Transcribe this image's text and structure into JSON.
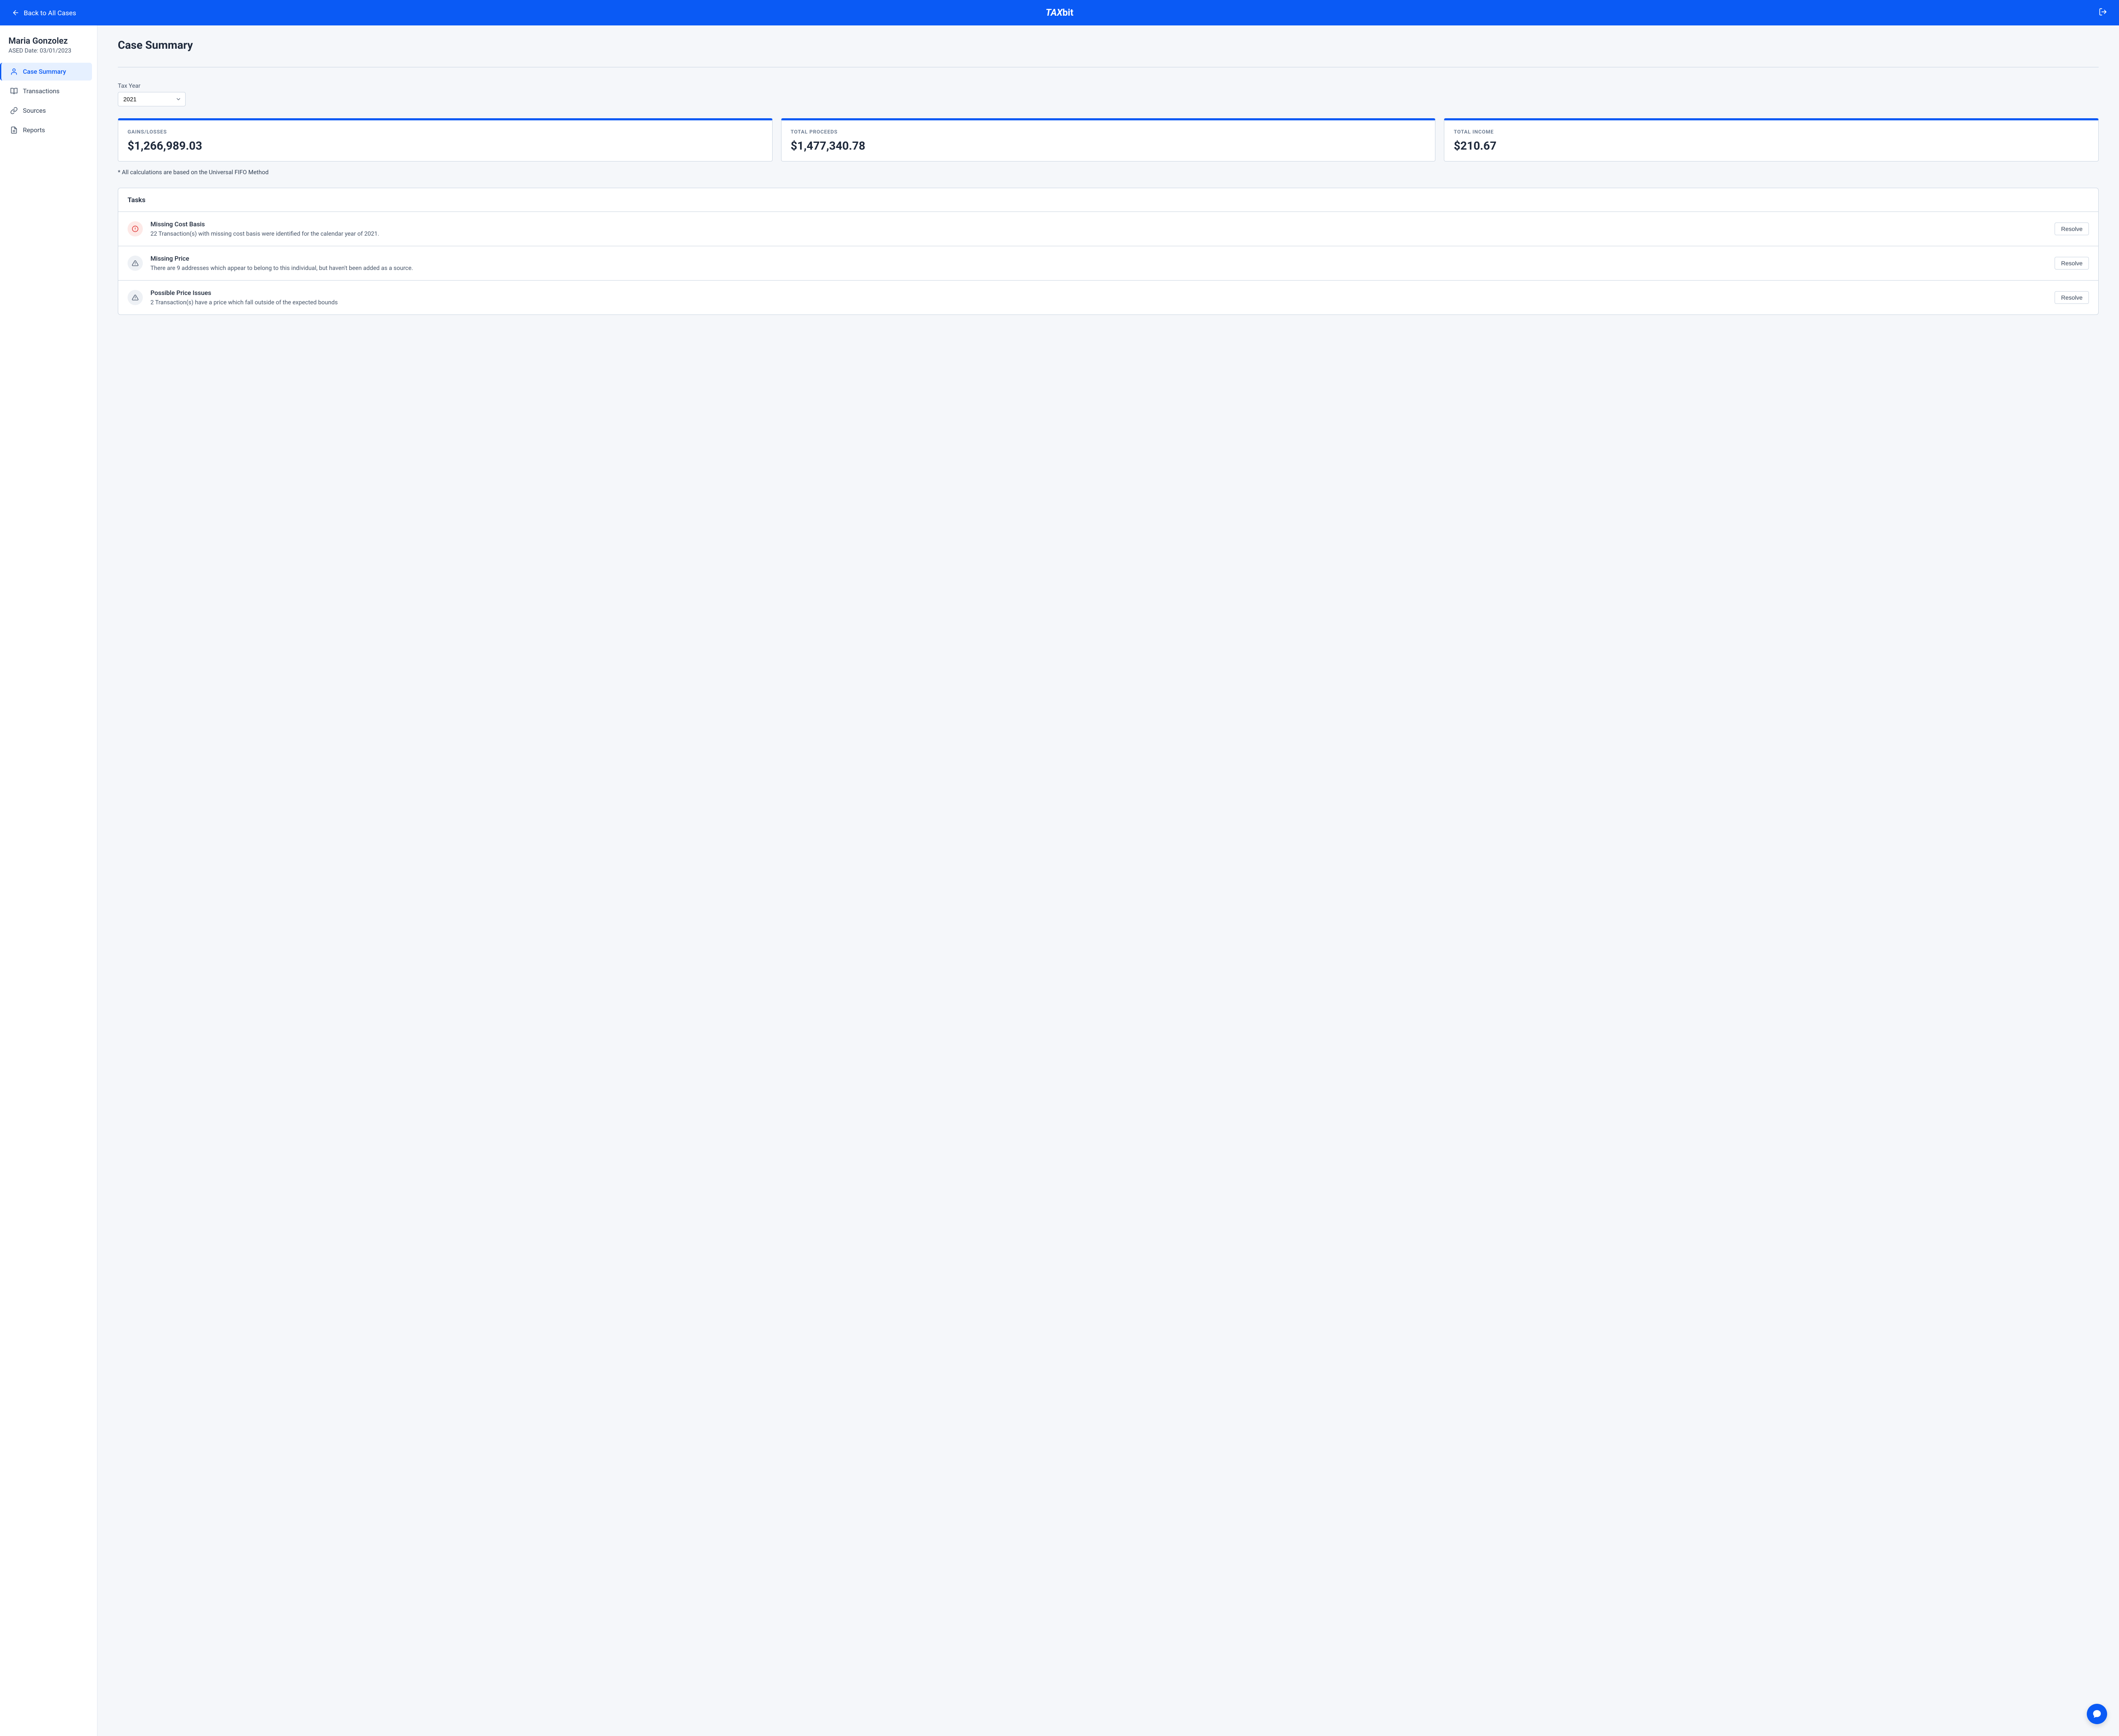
{
  "header": {
    "back_label": "Back to All Cases",
    "logo_prefix": "TAX",
    "logo_suffix": "bit"
  },
  "sidebar": {
    "person_name": "Maria Gonzolez",
    "ased_line": "ASED Date: 03/01/2023",
    "items": [
      {
        "label": "Case Summary",
        "icon": "person-icon",
        "active": true
      },
      {
        "label": "Transactions",
        "icon": "book-icon",
        "active": false
      },
      {
        "label": "Sources",
        "icon": "link-icon",
        "active": false
      },
      {
        "label": "Reports",
        "icon": "file-icon",
        "active": false
      }
    ]
  },
  "main": {
    "page_title": "Case Summary",
    "tax_year_label": "Tax Year",
    "tax_year_value": "2021",
    "cards": [
      {
        "label": "GAINS/LOSSES",
        "value": "$1,266,989.03"
      },
      {
        "label": "TOTAL PROCEEDS",
        "value": "$1,477,340.78"
      },
      {
        "label": "TOTAL INCOME",
        "value": "$210.67"
      }
    ],
    "footnote": "* All calculations are based on the Universal FIFO Method",
    "tasks_header": "Tasks",
    "resolve_label": "Resolve",
    "tasks": [
      {
        "severity": "error",
        "title": "Missing Cost Basis",
        "desc": "22 Transaction(s) with missing cost basis were identified for the calendar year of 2021."
      },
      {
        "severity": "warning",
        "title": "Missing Price",
        "desc": "There are 9 addresses which appear to belong to this individual, but haven't been added as a source."
      },
      {
        "severity": "warning",
        "title": "Possible Price Issues",
        "desc": "2 Transaction(s) have a price which fall outside of the expected bounds"
      }
    ]
  }
}
